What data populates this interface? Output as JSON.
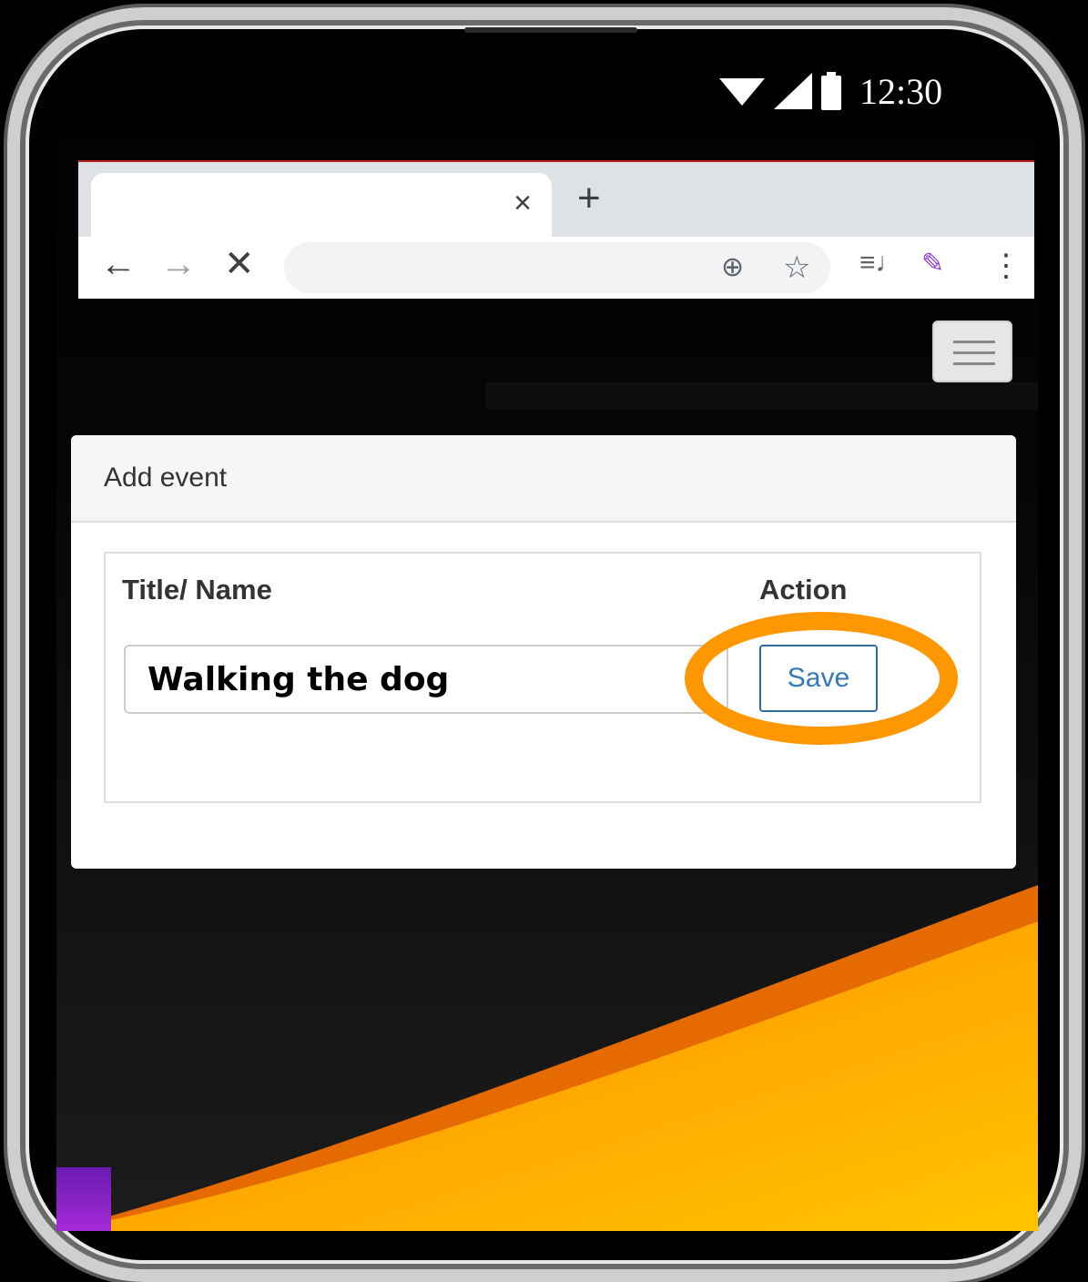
{
  "status_bar": {
    "time": "12:30",
    "icons": [
      "wifi-icon",
      "signal-icon",
      "battery-icon"
    ]
  },
  "browser": {
    "tab": {
      "title": "",
      "close_label": "×"
    },
    "new_tab_label": "+",
    "back_label": "←",
    "forward_label": "→",
    "stop_label": "✕",
    "address": "",
    "zoom_icon": "⊕",
    "star_icon": "☆",
    "media_icon": "≡♩",
    "extension_icon": "✎",
    "overflow_icon": "⋮"
  },
  "page": {
    "menu_button": "menu-icon",
    "card": {
      "header": "Add event",
      "columns": {
        "title": "Title/ Name",
        "action": "Action"
      },
      "title_value": "Walking the dog",
      "save_label": "Save"
    }
  },
  "colors": {
    "highlight": "#ff9800",
    "save_text": "#337ab7"
  }
}
